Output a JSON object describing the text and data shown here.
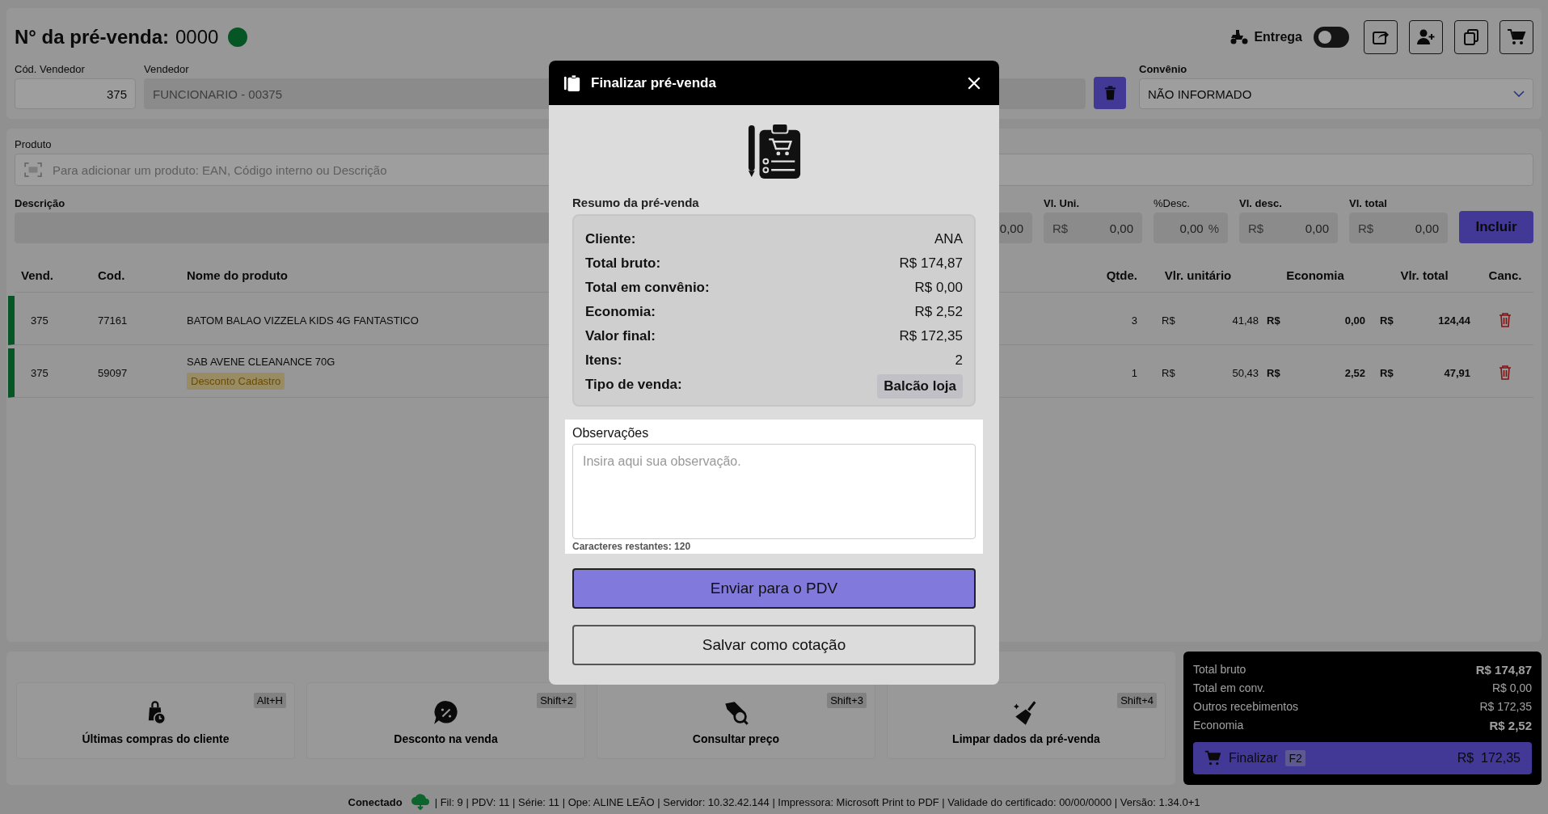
{
  "header": {
    "title_label": "N° da pré-venda:",
    "number": "0000",
    "status_ok": true,
    "delivery": {
      "label": "Entrega",
      "on": false
    }
  },
  "seller": {
    "code_label": "Cód. Vendedor",
    "code": "375",
    "name_label": "Vendedor",
    "name": "FUNCIONARIO - 00375"
  },
  "agreement": {
    "label": "Convênio",
    "value": "NÃO INFORMADO"
  },
  "product": {
    "label": "Produto",
    "placeholder": "Para adicionar um produto: EAN, Código interno ou Descrição"
  },
  "entry": {
    "description_label": "Descrição",
    "fields": [
      {
        "kind": "plain",
        "value": "0,00"
      },
      {
        "kind": "money",
        "label": "Vl. Uni.",
        "prefix": "R$",
        "value": "0,00"
      },
      {
        "kind": "percent",
        "label": "%Desc.",
        "value": "0,00",
        "suffix": "%"
      },
      {
        "kind": "money",
        "label": "Vl. desc.",
        "prefix": "R$",
        "value": "0,00"
      },
      {
        "kind": "money",
        "label": "Vl. total",
        "prefix": "R$",
        "value": "0,00"
      }
    ],
    "add_button": "Incluir"
  },
  "table": {
    "columns": [
      "Vend.",
      "Cod.",
      "Nome do produto",
      "Qtde.",
      "Vlr. unitário",
      "Economia",
      "Vlr. total",
      "Canc."
    ],
    "rows": [
      {
        "seller": "375",
        "code": "77161",
        "name": "BATOM BALAO VIZZELA KIDS 4G FANTASTICO",
        "qty": "3",
        "unit_currency": "R$",
        "unit": "41,48",
        "saving_currency": "R$",
        "saving": "0,00",
        "total_currency": "R$",
        "total": "124,44"
      },
      {
        "seller": "375",
        "code": "59097",
        "name": "SAB AVENE CLEANANCE 70G",
        "tag": "Desconto Cadastro",
        "qty": "1",
        "unit_currency": "R$",
        "unit": "50,43",
        "saving_currency": "R$",
        "saving": "2,52",
        "total_currency": "R$",
        "total": "47,91"
      }
    ]
  },
  "actions": [
    {
      "label": "Últimas compras do cliente",
      "shortcut": "Alt+H"
    },
    {
      "label": "Desconto na venda",
      "shortcut": "Shift+2"
    },
    {
      "label": "Consultar preço",
      "shortcut": "Shift+3"
    },
    {
      "label": "Limpar dados da pré-venda",
      "shortcut": "Shift+4"
    }
  ],
  "totals": {
    "rows": [
      {
        "label": "Total bruto",
        "value": "R$ 174,87",
        "bold": true
      },
      {
        "label": "Total em conv.",
        "value": "R$ 0,00",
        "bold": false
      },
      {
        "label": "Outros recebimentos",
        "value": "R$ 172,35",
        "bold": false
      },
      {
        "label": "Economia",
        "value": "R$ 2,52",
        "bold": true
      }
    ],
    "finalize": {
      "label": "Finalizar",
      "shortcut": "F2",
      "currency": "R$",
      "amount": "172,35"
    }
  },
  "status_bar": {
    "label": "Conectado",
    "connected": true,
    "details": "| Fil: 9 | PDV: 11 | Série: 11 | Ope: ALINE LEÃO | Servidor: 10.32.42.144 | Impressora: Microsoft Print to PDF | Validade do certificado: 00/00/0000 | Versão: 1.34.0+1"
  },
  "modal": {
    "title": "Finalizar pré-venda",
    "summary_title": "Resumo da pré-venda",
    "summary": [
      {
        "label": "Cliente:",
        "value": "ANA",
        "kind": "text"
      },
      {
        "label": "Total bruto:",
        "value": "R$ 174,87",
        "kind": "text"
      },
      {
        "label": "Total em convênio:",
        "value": "R$ 0,00",
        "kind": "text"
      },
      {
        "label": "Economia:",
        "value": "R$ 2,52",
        "kind": "text"
      },
      {
        "label": "Valor final:",
        "value": "R$ 172,35",
        "kind": "text"
      },
      {
        "label": "Itens:",
        "value": "2",
        "kind": "text"
      },
      {
        "label": "Tipo de venda:",
        "value": "Balcão loja",
        "kind": "chip"
      }
    ],
    "notes": {
      "label": "Observações",
      "placeholder": "Insira aqui sua observação.",
      "remaining": "Caracteres restantes: 120"
    },
    "primary_button": "Enviar para o PDV",
    "secondary_button": "Salvar como cotação"
  }
}
